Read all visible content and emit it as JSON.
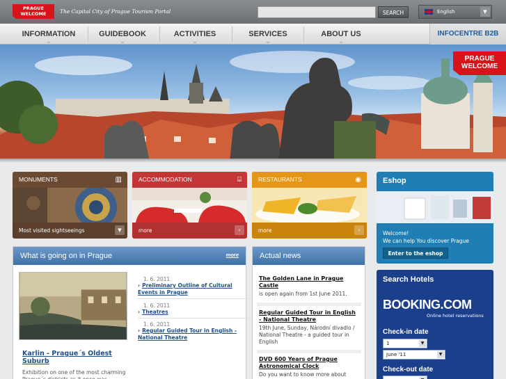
{
  "header": {
    "logo_line1": "PRAGUE",
    "logo_line2": "WELCOME",
    "tagline": "The Capital City of Prague Tourism Portal",
    "search_placeholder": "",
    "search_button": "SEARCH",
    "language": "English"
  },
  "nav": {
    "items": [
      "INFORMATION",
      "GUIDEBOOK",
      "ACTIVITIES",
      "SERVICES",
      "ABOUT US"
    ],
    "b2b": "INFOCENTRE B2B"
  },
  "hero": {
    "badge_line1": "PRAGUE",
    "badge_line2": "WELCOME"
  },
  "tiles": [
    {
      "title": "MONUMENTS",
      "footer": "Most visited sightseeings",
      "color": "#6d4b35",
      "icon": "castle-icon"
    },
    {
      "title": "ACCOMMODATION",
      "footer": "more",
      "color": "#c63a3a",
      "icon": "bed-icon"
    },
    {
      "title": "RESTAURANTS",
      "footer": "more",
      "color": "#e59a1c",
      "icon": "dish-icon"
    }
  ],
  "eshop": {
    "title": "Eshop",
    "welcome": "Welcome!",
    "text": "We can help You discover Prague",
    "button": "Enter to the eshop"
  },
  "whats_on": {
    "title": "What is going on in Prague",
    "more": "more",
    "feature_title": "Karlin - Prague´s Oldest Suburb",
    "feature_desc": "Exhibition on one of the most charming Prague´s districts as it once was",
    "events": [
      {
        "date": "1. 6. 2011",
        "title": "Preliminary Outline of Cultural Events in Prague"
      },
      {
        "date": "1. 6. 2011",
        "title": "Theatres"
      },
      {
        "date": "1. 6. 2011",
        "title": "Regular Guided Tour in English - National Theatre"
      }
    ]
  },
  "news": {
    "title": "Actual news",
    "items": [
      {
        "title": "The Golden Lane in Prague Castle",
        "text": "is open again from 1st June 2011."
      },
      {
        "title": "Regular Guided Tour in English - National Theatre",
        "text": "19th June, Sunday, Národní divadlo / National Theatre - a guided tour in English"
      },
      {
        "title": "DVD 600 Years of Prague Astronomical Clock",
        "text": "Do you want to know more about"
      }
    ]
  },
  "hotels": {
    "title": "Search Hotels",
    "brand": "BOOKING.COM",
    "brand_sub": "Online hotel reservations",
    "checkin_label": "Check-in date",
    "checkin_day": "1",
    "checkin_month": "June '11",
    "checkout_label": "Check-out date"
  }
}
